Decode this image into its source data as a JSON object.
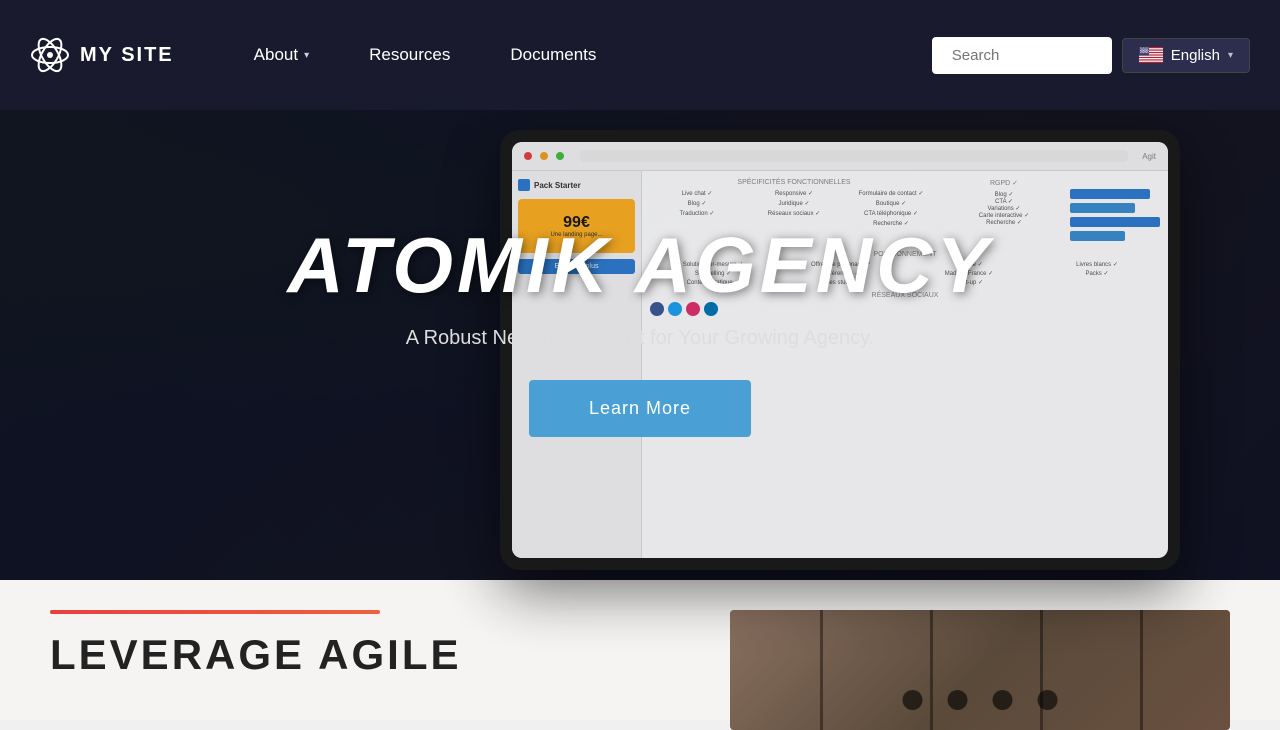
{
  "site": {
    "logo_text": "MY SITE",
    "logo_icon": "atom"
  },
  "nav": {
    "links": [
      {
        "label": "About",
        "has_dropdown": true
      },
      {
        "label": "Resources",
        "has_dropdown": false
      },
      {
        "label": "Documents",
        "has_dropdown": false
      }
    ],
    "search_placeholder": "Search",
    "language": {
      "label": "English",
      "flag": "us"
    }
  },
  "hero": {
    "title": "ATOMIK AGENCY",
    "subtitle": "A Robust New Theme Built for Your Growing Agency.",
    "cta_label": "Learn More"
  },
  "bottom": {
    "section_title": "LEVERAGE AGILE",
    "accent_color": "#e84040"
  }
}
